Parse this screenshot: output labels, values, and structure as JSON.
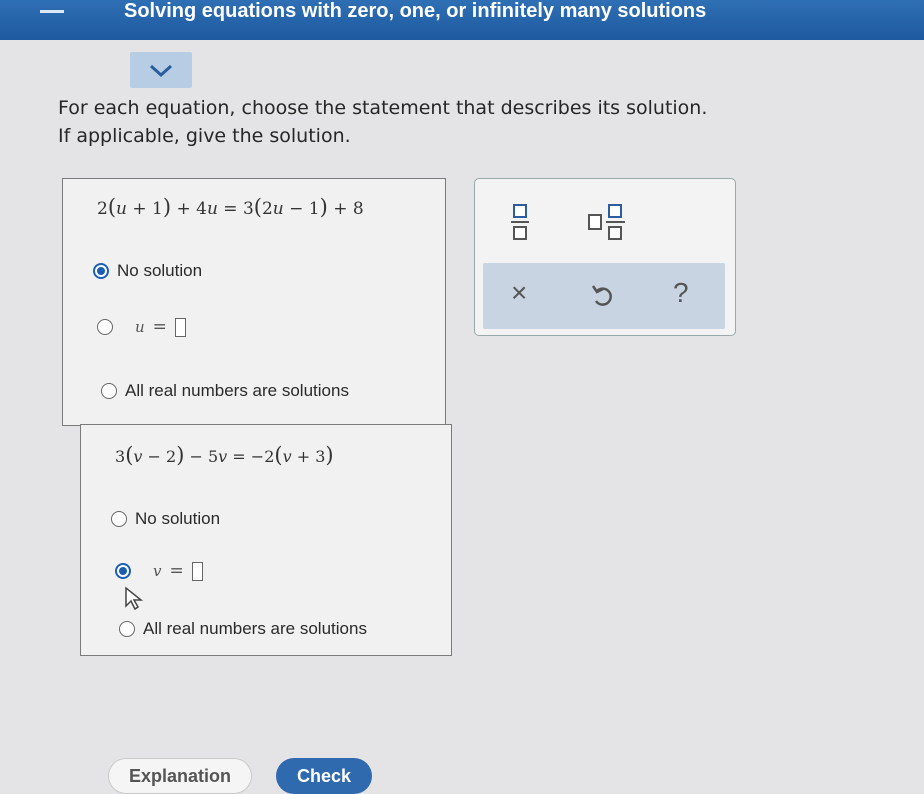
{
  "header": {
    "title": "Solving equations with zero, one, or infinitely many solutions"
  },
  "instructions": {
    "line1": "For each equation, choose the statement that describes its solution.",
    "line2": "If applicable, give the solution."
  },
  "problems": [
    {
      "variable": "u",
      "equation": "2(u + 1) + 4u = 3(2u − 1) + 8",
      "options": [
        {
          "label": "No solution",
          "selected": true
        },
        {
          "label": "u =",
          "selected": false
        },
        {
          "label": "All real numbers are solutions",
          "selected": false
        }
      ]
    },
    {
      "variable": "v",
      "equation": "3(v − 2) − 5v = −2(v + 3)",
      "options": [
        {
          "label": "No solution",
          "selected": false
        },
        {
          "label": "v =",
          "selected": true
        },
        {
          "label": "All real numbers are solutions",
          "selected": false
        }
      ]
    }
  ],
  "toolbox": {
    "fraction_icon": "fraction-icon",
    "mixed_number_icon": "mixed-number-icon",
    "clear": "×",
    "undo_icon": "undo-icon",
    "help": "?"
  },
  "buttons": {
    "explanation": "Explanation",
    "check": "Check"
  },
  "colors": {
    "header": "#1e5aa0",
    "accent": "#2f6aaf",
    "selected_radio": "#1b5fb3"
  }
}
